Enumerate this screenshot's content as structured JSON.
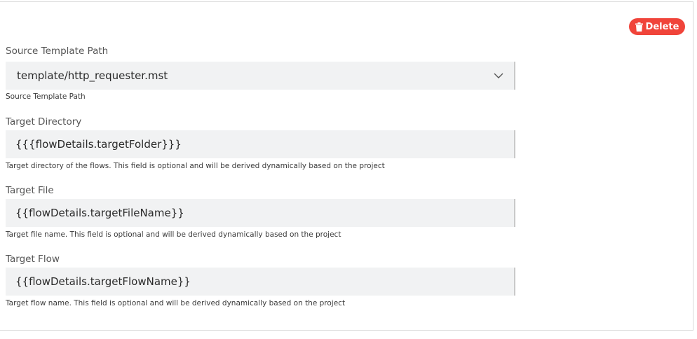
{
  "toolbar": {
    "delete_label": "Delete"
  },
  "fields": {
    "source_template": {
      "label": "Source Template Path",
      "value": "template/http_requester.mst",
      "help": "Source Template Path"
    },
    "target_directory": {
      "label": "Target Directory",
      "value": "{{{flowDetails.targetFolder}}}",
      "help": "Target directory of the flows. This field is optional and will be derived dynamically based on the project"
    },
    "target_file": {
      "label": "Target File",
      "value": "{{flowDetails.targetFileName}}",
      "help": "Target file name. This field is optional and will be derived dynamically based on the project"
    },
    "target_flow": {
      "label": "Target Flow",
      "value": "{{flowDetails.targetFlowName}}",
      "help": "Target flow name. This field is optional and will be derived dynamically based on the project"
    }
  },
  "colors": {
    "delete_button": "#f0443a",
    "field_background": "#f1f2f3"
  },
  "icons": {
    "delete": "trash-icon",
    "select": "chevron-down-icon"
  }
}
